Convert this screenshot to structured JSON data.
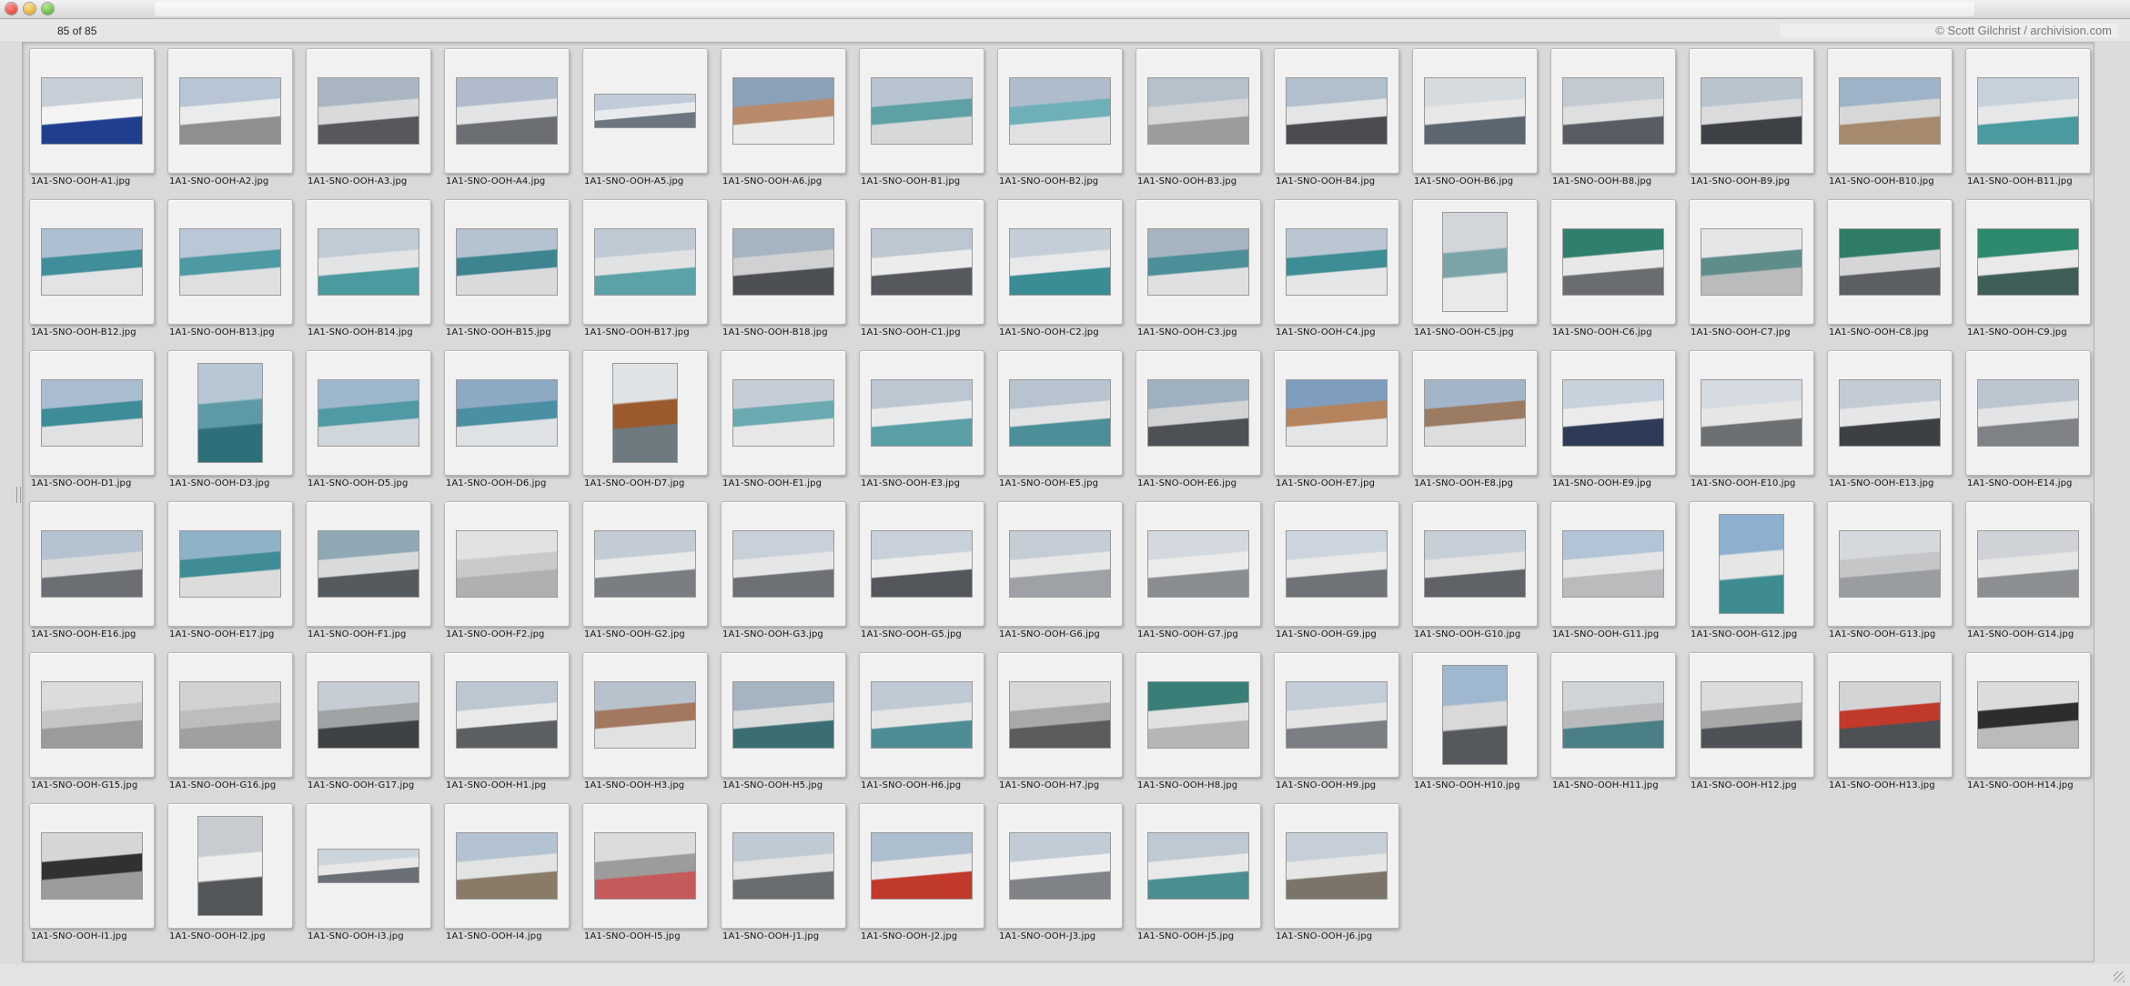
{
  "window": {
    "count_text": "85 of 85",
    "copyright": "© Scott Gilchrist / archivision.com"
  },
  "images": [
    {
      "name": "1A1-SNO-OOH-A1.jpg",
      "palette": [
        "#c9cfd8",
        "#f4f4f4",
        "#1f3f8e"
      ],
      "shape": "land"
    },
    {
      "name": "1A1-SNO-OOH-A2.jpg",
      "palette": [
        "#b7c5d5",
        "#e9ebec",
        "#8f8f92"
      ],
      "shape": "land"
    },
    {
      "name": "1A1-SNO-OOH-A3.jpg",
      "palette": [
        "#a9b6c2",
        "#d8dadb",
        "#56585c"
      ],
      "shape": "land"
    },
    {
      "name": "1A1-SNO-OOH-A4.jpg",
      "palette": [
        "#b0bccb",
        "#e2e4e6",
        "#6b6e72"
      ],
      "shape": "land"
    },
    {
      "name": "1A1-SNO-OOH-A5.jpg",
      "palette": [
        "#c1ccd8",
        "#e8ebee",
        "#6c7680"
      ],
      "shape": "pano"
    },
    {
      "name": "1A1-SNO-OOH-A6.jpg",
      "palette": [
        "#8aa1b8",
        "#b88a6b",
        "#eaeaea"
      ],
      "shape": "land"
    },
    {
      "name": "1A1-SNO-OOH-B1.jpg",
      "palette": [
        "#b8c4d0",
        "#5fa0a5",
        "#d6d8d9"
      ],
      "shape": "land"
    },
    {
      "name": "1A1-SNO-OOH-B2.jpg",
      "palette": [
        "#aebccc",
        "#6fb0b8",
        "#dfe1e3"
      ],
      "shape": "land"
    },
    {
      "name": "1A1-SNO-OOH-B3.jpg",
      "palette": [
        "#b6c1cc",
        "#d5d7d9",
        "#9a9c9e"
      ],
      "shape": "land"
    },
    {
      "name": "1A1-SNO-OOH-B4.jpg",
      "palette": [
        "#b2bfcc",
        "#e4e5e6",
        "#4a4c50"
      ],
      "shape": "land"
    },
    {
      "name": "1A1-SNO-OOH-B6.jpg",
      "palette": [
        "#d6dbe0",
        "#e8e8e8",
        "#5b6670"
      ],
      "shape": "land"
    },
    {
      "name": "1A1-SNO-OOH-B8.jpg",
      "palette": [
        "#c3cad1",
        "#dedfe0",
        "#585d63"
      ],
      "shape": "land"
    },
    {
      "name": "1A1-SNO-OOH-B9.jpg",
      "palette": [
        "#b9c4cf",
        "#d9dbdd",
        "#3d4045"
      ],
      "shape": "land"
    },
    {
      "name": "1A1-SNO-OOH-B10.jpg",
      "palette": [
        "#9fb3c8",
        "#d7d7d7",
        "#a68a6e"
      ],
      "shape": "land"
    },
    {
      "name": "1A1-SNO-OOH-B11.jpg",
      "palette": [
        "#c7d1dc",
        "#e6e7e8",
        "#4a9aa0"
      ],
      "shape": "land"
    },
    {
      "name": "1A1-SNO-OOH-B12.jpg",
      "palette": [
        "#aebfd1",
        "#3f8e9a",
        "#e2e3e4"
      ],
      "shape": "land"
    },
    {
      "name": "1A1-SNO-OOH-B13.jpg",
      "palette": [
        "#b9c7d6",
        "#4d9aa4",
        "#dedfe0"
      ],
      "shape": "land"
    },
    {
      "name": "1A1-SNO-OOH-B14.jpg",
      "palette": [
        "#c0cbd6",
        "#e3e4e5",
        "#4b9aa0"
      ],
      "shape": "land"
    },
    {
      "name": "1A1-SNO-OOH-B15.jpg",
      "palette": [
        "#b5c2cf",
        "#3d8490",
        "#d9dadb"
      ],
      "shape": "land"
    },
    {
      "name": "1A1-SNO-OOH-B17.jpg",
      "palette": [
        "#bfcad5",
        "#e1e2e3",
        "#5aa2a8"
      ],
      "shape": "land"
    },
    {
      "name": "1A1-SNO-OOH-B18.jpg",
      "palette": [
        "#a7b4c1",
        "#cfd1d3",
        "#4c5055"
      ],
      "shape": "land"
    },
    {
      "name": "1A1-SNO-OOH-C1.jpg",
      "palette": [
        "#bcc7d2",
        "#ececec",
        "#55595e"
      ],
      "shape": "land"
    },
    {
      "name": "1A1-SNO-OOH-C2.jpg",
      "palette": [
        "#c4ced8",
        "#e8e9ea",
        "#3a8c95"
      ],
      "shape": "land"
    },
    {
      "name": "1A1-SNO-OOH-C3.jpg",
      "palette": [
        "#a6b3c0",
        "#4c8f99",
        "#dfe0e1"
      ],
      "shape": "land"
    },
    {
      "name": "1A1-SNO-OOH-C4.jpg",
      "palette": [
        "#bac6d2",
        "#3d8d96",
        "#e5e6e7"
      ],
      "shape": "land"
    },
    {
      "name": "1A1-SNO-OOH-C5.jpg",
      "palette": [
        "#d2d6da",
        "#7aa4a8",
        "#e9e9e9"
      ],
      "shape": "portrait"
    },
    {
      "name": "1A1-SNO-OOH-C6.jpg",
      "palette": [
        "#2f7f6f",
        "#e8e8e8",
        "#6a6d70"
      ],
      "shape": "land"
    },
    {
      "name": "1A1-SNO-OOH-C7.jpg",
      "palette": [
        "#e5e6e7",
        "#5f8d8a",
        "#b9bbbd"
      ],
      "shape": "land"
    },
    {
      "name": "1A1-SNO-OOH-C8.jpg",
      "palette": [
        "#2e7c66",
        "#d5d6d7",
        "#5c5f62"
      ],
      "shape": "land"
    },
    {
      "name": "1A1-SNO-OOH-C9.jpg",
      "palette": [
        "#2d8a6f",
        "#e9e9e9",
        "#3f5e58"
      ],
      "shape": "land"
    },
    {
      "name": "1A1-SNO-OOH-D1.jpg",
      "palette": [
        "#aabdd0",
        "#3e8c98",
        "#e0e1e2"
      ],
      "shape": "land"
    },
    {
      "name": "1A1-SNO-OOH-D3.jpg",
      "palette": [
        "#b7c7d4",
        "#5d9aa6",
        "#2f6f7a"
      ],
      "shape": "portrait"
    },
    {
      "name": "1A1-SNO-OOH-D5.jpg",
      "palette": [
        "#9fb7cc",
        "#4f9aa4",
        "#cfd6dc"
      ],
      "shape": "land"
    },
    {
      "name": "1A1-SNO-OOH-D6.jpg",
      "palette": [
        "#8ea9c4",
        "#4b8fa2",
        "#dfe2e5"
      ],
      "shape": "land"
    },
    {
      "name": "1A1-SNO-OOH-D7.jpg",
      "palette": [
        "#dfe3e6",
        "#9a5a2e",
        "#6d7a80"
      ],
      "shape": "portrait"
    },
    {
      "name": "1A1-SNO-OOH-E1.jpg",
      "palette": [
        "#c5ced7",
        "#6aaab0",
        "#e7e7e7"
      ],
      "shape": "land"
    },
    {
      "name": "1A1-SNO-OOH-E3.jpg",
      "palette": [
        "#bcc7d2",
        "#e9eaeb",
        "#5b9fa6"
      ],
      "shape": "land"
    },
    {
      "name": "1A1-SNO-OOH-E5.jpg",
      "palette": [
        "#b7c3cf",
        "#e2e3e4",
        "#4c8f98"
      ],
      "shape": "land"
    },
    {
      "name": "1A1-SNO-OOH-E6.jpg",
      "palette": [
        "#9fb0c0",
        "#d1d3d5",
        "#4d5156"
      ],
      "shape": "land"
    },
    {
      "name": "1A1-SNO-OOH-E7.jpg",
      "palette": [
        "#7f9ebf",
        "#b4845e",
        "#e4e5e6"
      ],
      "shape": "land"
    },
    {
      "name": "1A1-SNO-OOH-E8.jpg",
      "palette": [
        "#a3b6c9",
        "#9b7b62",
        "#dcdddf"
      ],
      "shape": "land"
    },
    {
      "name": "1A1-SNO-OOH-E9.jpg",
      "palette": [
        "#c7d2dc",
        "#ebebeb",
        "#2e3a56"
      ],
      "shape": "land"
    },
    {
      "name": "1A1-SNO-OOH-E10.jpg",
      "palette": [
        "#d5dbe0",
        "#e6e6e6",
        "#6d7073"
      ],
      "shape": "land"
    },
    {
      "name": "1A1-SNO-OOH-E13.jpg",
      "palette": [
        "#c3ccd5",
        "#e5e6e7",
        "#3c3f44"
      ],
      "shape": "land"
    },
    {
      "name": "1A1-SNO-OOH-E14.jpg",
      "palette": [
        "#bcc6d0",
        "#e3e4e5",
        "#7e8286"
      ],
      "shape": "land"
    },
    {
      "name": "1A1-SNO-OOH-E16.jpg",
      "palette": [
        "#b5c3d1",
        "#d9dadb",
        "#6b6f74"
      ],
      "shape": "land"
    },
    {
      "name": "1A1-SNO-OOH-E17.jpg",
      "palette": [
        "#8fb2c8",
        "#3f8c97",
        "#dcdcdc"
      ],
      "shape": "land"
    },
    {
      "name": "1A1-SNO-OOH-F1.jpg",
      "palette": [
        "#8fa8b4",
        "#d9dadb",
        "#555a5e"
      ],
      "shape": "land"
    },
    {
      "name": "1A1-SNO-OOH-F2.jpg",
      "palette": [
        "#e1e2e3",
        "#c9cacb",
        "#aeb0b2"
      ],
      "shape": "land"
    },
    {
      "name": "1A1-SNO-OOH-G2.jpg",
      "palette": [
        "#c3ccd5",
        "#e9eaea",
        "#7a7e82"
      ],
      "shape": "land"
    },
    {
      "name": "1A1-SNO-OOH-G3.jpg",
      "palette": [
        "#c8d1da",
        "#e5e6e7",
        "#6d7176"
      ],
      "shape": "land"
    },
    {
      "name": "1A1-SNO-OOH-G5.jpg",
      "palette": [
        "#c8d1da",
        "#ececec",
        "#53565a"
      ],
      "shape": "land"
    },
    {
      "name": "1A1-SNO-OOH-G6.jpg",
      "palette": [
        "#c4cdd6",
        "#e7e8e8",
        "#9ea2a6"
      ],
      "shape": "land"
    },
    {
      "name": "1A1-SNO-OOH-G7.jpg",
      "palette": [
        "#d3d9df",
        "#ebebeb",
        "#8a8d90"
      ],
      "shape": "land"
    },
    {
      "name": "1A1-SNO-OOH-G9.jpg",
      "palette": [
        "#ccd5dd",
        "#e9e9e9",
        "#6f7377"
      ],
      "shape": "land"
    },
    {
      "name": "1A1-SNO-OOH-G10.jpg",
      "palette": [
        "#c6cfd8",
        "#e3e3e3",
        "#5f6368"
      ],
      "shape": "land"
    },
    {
      "name": "1A1-SNO-OOH-G11.jpg",
      "palette": [
        "#b2c4d6",
        "#e4e5e6",
        "#b9bbbd"
      ],
      "shape": "land"
    },
    {
      "name": "1A1-SNO-OOH-G12.jpg",
      "palette": [
        "#8eb0d0",
        "#e6e6e6",
        "#3e8c8f"
      ],
      "shape": "portrait"
    },
    {
      "name": "1A1-SNO-OOH-G13.jpg",
      "palette": [
        "#d5d9dd",
        "#c4c6c8",
        "#9a9da0"
      ],
      "shape": "land"
    },
    {
      "name": "1A1-SNO-OOH-G14.jpg",
      "palette": [
        "#cfd3d7",
        "#e6e6e6",
        "#8c8f92"
      ],
      "shape": "land"
    },
    {
      "name": "1A1-SNO-OOH-G15.jpg",
      "palette": [
        "#dcdcdc",
        "#c5c5c5",
        "#9b9b9b"
      ],
      "shape": "land"
    },
    {
      "name": "1A1-SNO-OOH-G16.jpg",
      "palette": [
        "#d2d2d2",
        "#bdbdbd",
        "#a0a0a0"
      ],
      "shape": "land"
    },
    {
      "name": "1A1-SNO-OOH-G17.jpg",
      "palette": [
        "#c5ccd3",
        "#9fa3a6",
        "#3f4245"
      ],
      "shape": "land"
    },
    {
      "name": "1A1-SNO-OOH-H1.jpg",
      "palette": [
        "#bcc7d2",
        "#e9e9e9",
        "#5c5f62"
      ],
      "shape": "land"
    },
    {
      "name": "1A1-SNO-OOH-H3.jpg",
      "palette": [
        "#b8c2cc",
        "#a37860",
        "#e1e1e1"
      ],
      "shape": "land"
    },
    {
      "name": "1A1-SNO-OOH-H5.jpg",
      "palette": [
        "#a6b3c0",
        "#dadbdc",
        "#3b6e73"
      ],
      "shape": "land"
    },
    {
      "name": "1A1-SNO-OOH-H6.jpg",
      "palette": [
        "#c0cad4",
        "#e5e5e5",
        "#4f8d95"
      ],
      "shape": "land"
    },
    {
      "name": "1A1-SNO-OOH-H7.jpg",
      "palette": [
        "#d7d7d7",
        "#a9a9a9",
        "#5c5c5c"
      ],
      "shape": "land"
    },
    {
      "name": "1A1-SNO-OOH-H8.jpg",
      "palette": [
        "#3a7e78",
        "#e1e1e1",
        "#b4b6b8"
      ],
      "shape": "land"
    },
    {
      "name": "1A1-SNO-OOH-H9.jpg",
      "palette": [
        "#c3cdd7",
        "#e4e4e4",
        "#7b7e82"
      ],
      "shape": "land"
    },
    {
      "name": "1A1-SNO-OOH-H10.jpg",
      "palette": [
        "#9fb7cf",
        "#d9d9d9",
        "#55595d"
      ],
      "shape": "portrait"
    },
    {
      "name": "1A1-SNO-OOH-H11.jpg",
      "palette": [
        "#cfd4d9",
        "#b8babc",
        "#4a7f85"
      ],
      "shape": "land"
    },
    {
      "name": "1A1-SNO-OOH-H12.jpg",
      "palette": [
        "#dcdcdc",
        "#a8a8a8",
        "#4e5155"
      ],
      "shape": "land"
    },
    {
      "name": "1A1-SNO-OOH-H13.jpg",
      "palette": [
        "#d2d4d6",
        "#c0392b",
        "#4d5054"
      ],
      "shape": "land"
    },
    {
      "name": "1A1-SNO-OOH-H14.jpg",
      "palette": [
        "#dbdcdd",
        "#2c2d2f",
        "#b9bbbd"
      ],
      "shape": "land"
    },
    {
      "name": "1A1-SNO-OOH-I1.jpg",
      "palette": [
        "#d5d6d7",
        "#2f3133",
        "#9a9c9e"
      ],
      "shape": "land"
    },
    {
      "name": "1A1-SNO-OOH-I2.jpg",
      "palette": [
        "#c8ccd0",
        "#eeeeee",
        "#545759"
      ],
      "shape": "portrait"
    },
    {
      "name": "1A1-SNO-OOH-I3.jpg",
      "palette": [
        "#cdd5dc",
        "#e7e7e7",
        "#6a7075"
      ],
      "shape": "pano"
    },
    {
      "name": "1A1-SNO-OOH-I4.jpg",
      "palette": [
        "#b4c3d2",
        "#e2e3e4",
        "#8a7a68"
      ],
      "shape": "land"
    },
    {
      "name": "1A1-SNO-OOH-I5.jpg",
      "palette": [
        "#dcdcdc",
        "#9c9c9c",
        "#c45a5a"
      ],
      "shape": "land"
    },
    {
      "name": "1A1-SNO-OOH-J1.jpg",
      "palette": [
        "#c0cad4",
        "#e3e3e3",
        "#6a6d70"
      ],
      "shape": "land"
    },
    {
      "name": "1A1-SNO-OOH-J2.jpg",
      "palette": [
        "#aebfd0",
        "#e8e8e8",
        "#c0392b"
      ],
      "shape": "land"
    },
    {
      "name": "1A1-SNO-OOH-J3.jpg",
      "palette": [
        "#c2ccd6",
        "#f0f0f0",
        "#7f8387"
      ],
      "shape": "land"
    },
    {
      "name": "1A1-SNO-OOH-J5.jpg",
      "palette": [
        "#bfc9d3",
        "#e9e9e9",
        "#4b8e90"
      ],
      "shape": "land"
    },
    {
      "name": "1A1-SNO-OOH-J6.jpg",
      "palette": [
        "#c6cfd8",
        "#e6e6e6",
        "#7b7468"
      ],
      "shape": "land"
    }
  ]
}
